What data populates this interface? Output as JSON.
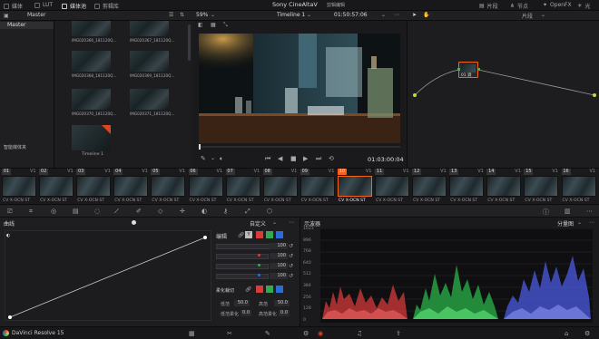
{
  "topbar": {
    "items": [
      "媒体",
      "LUT",
      "媒体池",
      "剪辑库"
    ],
    "title": "Sony CineAltaV",
    "subtitle": "剪辑编辑",
    "right_items": [
      "片段",
      "节点",
      "OpenFX",
      "光"
    ]
  },
  "toolbar2": {
    "master_label": "Master",
    "zoom": "59%",
    "timeline_name": "Timeline 1",
    "timecode_top": "01:50:57:06",
    "clip_menu": "片段"
  },
  "media_panel": {
    "tree_items": [
      "Master"
    ],
    "smart_bins": "智能媒体夹",
    "thumbs": [
      {
        "label": "IMG020366_181120Q..."
      },
      {
        "label": "IMG020367_181120Q..."
      },
      {
        "label": "IMG020368_181120Q..."
      },
      {
        "label": "IMG020369_181120Q..."
      },
      {
        "label": "IMG020370_181120Q..."
      },
      {
        "label": "IMG020371_181120Q..."
      },
      {
        "label": "IMG020372_181120Q..."
      }
    ],
    "timeline_thumb_label": "Timeline 1"
  },
  "viewer": {
    "timecode": "01:03:00:04"
  },
  "node": {
    "label": "01 调"
  },
  "clips": [
    {
      "num": "01",
      "track": "V1",
      "label": "CV X-OCN ST"
    },
    {
      "num": "02",
      "track": "V1",
      "label": "CV X-OCN ST"
    },
    {
      "num": "03",
      "track": "V1",
      "label": "CV X-OCN ST"
    },
    {
      "num": "04",
      "track": "V1",
      "label": "CV X-OCN ST"
    },
    {
      "num": "05",
      "track": "V1",
      "label": "CV X-OCN ST"
    },
    {
      "num": "06",
      "track": "V1",
      "label": "CV X-OCN ST"
    },
    {
      "num": "07",
      "track": "V1",
      "label": "CV X-OCN ST"
    },
    {
      "num": "08",
      "track": "V1",
      "label": "CV X-OCN ST"
    },
    {
      "num": "09",
      "track": "V1",
      "label": "CV X-OCN ST"
    },
    {
      "num": "10",
      "track": "V1",
      "label": "CV X-OCN ST"
    },
    {
      "num": "11",
      "track": "V1",
      "label": "CV X-OCN ST"
    },
    {
      "num": "12",
      "track": "V1",
      "label": "CV X-OCN ST"
    },
    {
      "num": "13",
      "track": "V1",
      "label": "CV X-OCN ST"
    },
    {
      "num": "14",
      "track": "V1",
      "label": "CV X-OCN ST"
    },
    {
      "num": "15",
      "track": "V1",
      "label": "CV X-OCN ST"
    },
    {
      "num": "16",
      "track": "V1",
      "label": "CV X-OCN ST"
    }
  ],
  "curves": {
    "title": "曲线",
    "mode": "自定义",
    "edit_label": "编辑",
    "y_label": "Y",
    "intensity": [
      "100",
      "100",
      "100",
      "100"
    ],
    "soft_clip": "柔化裁切",
    "fields": [
      {
        "label": "低范",
        "value": "50.0"
      },
      {
        "label": "高范",
        "value": "50.0"
      },
      {
        "label": "低范柔化",
        "value": "0.0"
      },
      {
        "label": "高范柔化",
        "value": "0.0"
      }
    ]
  },
  "scopes": {
    "title": "示波器",
    "mode": "分量图",
    "axis_labels": [
      "1023",
      "896",
      "768",
      "640",
      "512",
      "384",
      "256",
      "128",
      "0"
    ]
  },
  "footer": {
    "app_name": "DaVinci Resolve 15"
  },
  "colors": {
    "accent": "#e0441e",
    "selected": "#f2641e",
    "node_green": "#4caf50",
    "red": "#d93a3a",
    "green": "#34a853",
    "blue": "#2f6bd8"
  }
}
